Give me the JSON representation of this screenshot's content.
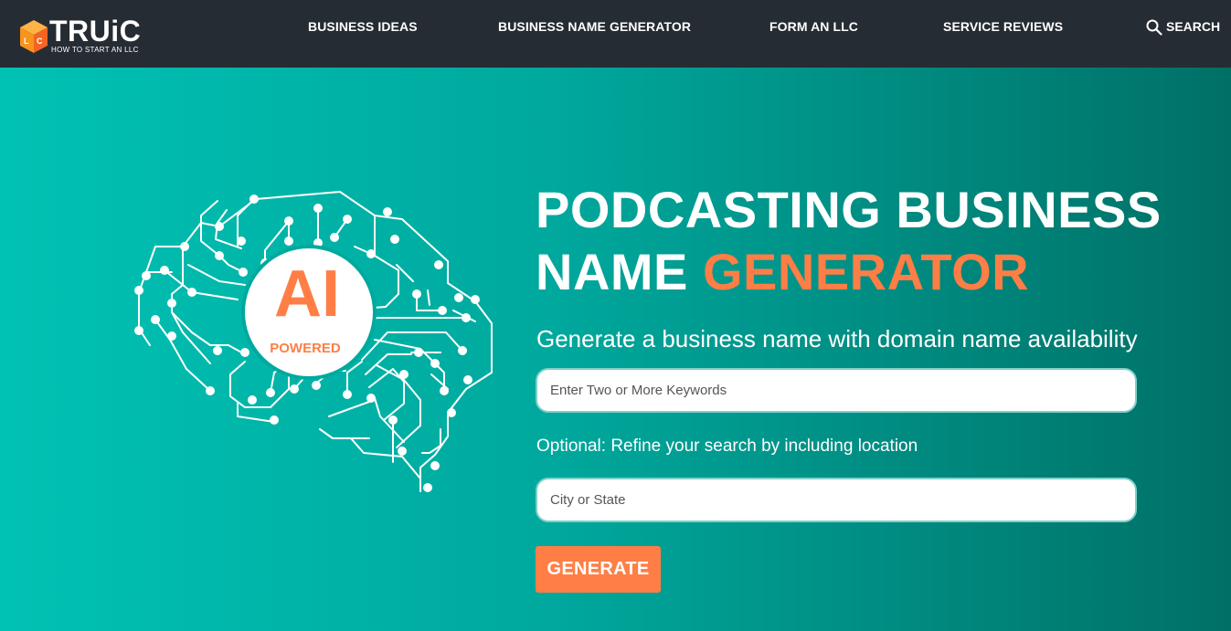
{
  "header": {
    "logo_text": "TRUiC",
    "logo_subtext": "HOW TO START AN LLC",
    "logo_cube_letters": "LLC",
    "nav": [
      {
        "label": "BUSINESS IDEAS"
      },
      {
        "label": "BUSINESS NAME GENERATOR"
      },
      {
        "label": "FORM AN LLC"
      },
      {
        "label": "SERVICE REVIEWS"
      }
    ],
    "search_label": "SEARCH"
  },
  "hero": {
    "badge_main": "AI",
    "badge_sub": "POWERED",
    "title_white": "PODCASTING BUSINESS NAME",
    "title_accent": "GENERATOR",
    "subtitle": "Generate a business name with domain name availability",
    "keywords_placeholder": "Enter Two or More Keywords",
    "optional_text": "Optional: Refine your search by including location",
    "location_placeholder": "City or State",
    "generate_label": "GENERATE"
  },
  "colors": {
    "header_bg": "#262c33",
    "accent_orange": "#ff7e45",
    "teal_light": "#00c2b4",
    "teal_dark": "#007066"
  }
}
